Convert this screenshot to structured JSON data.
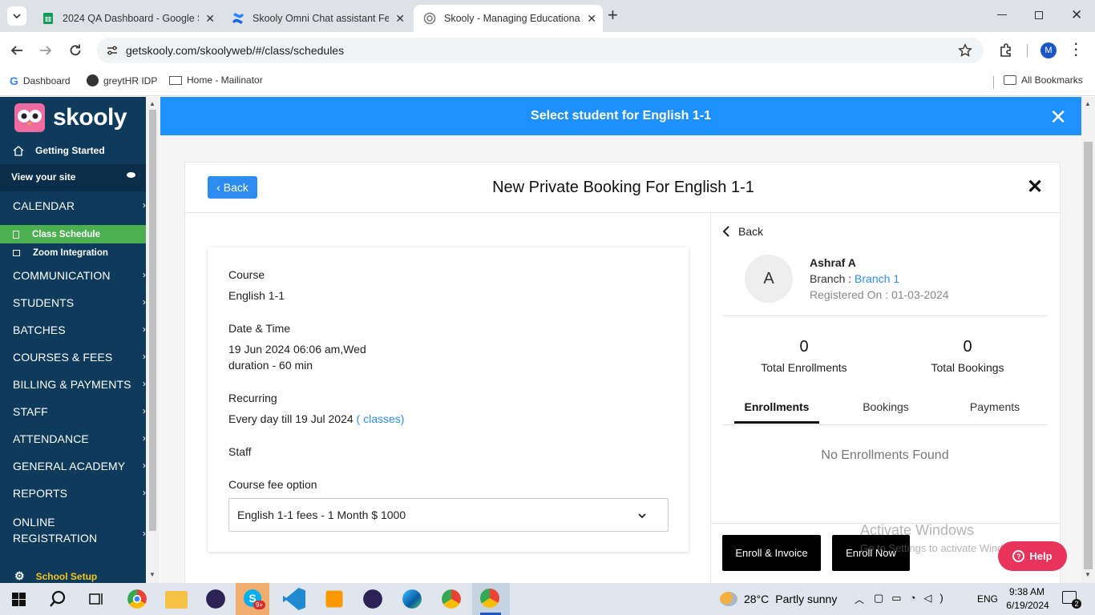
{
  "browser": {
    "tabs": [
      {
        "title": "2024 QA Dashboard - Google S",
        "icon": "sheets-icon"
      },
      {
        "title": "Skooly Omni Chat assistant Fea",
        "icon": "confluence-icon"
      },
      {
        "title": "Skooly - Managing Educational",
        "icon": "globe-icon"
      }
    ],
    "url": "getskooly.com/skoolyweb/#/class/schedules",
    "bookmarks": [
      "Dashboard",
      "greytHR IDP",
      "Home - Mailinator"
    ],
    "all_bookmarks": "All Bookmarks",
    "profile_initial": "M"
  },
  "sidebar": {
    "logo": "skooly",
    "getting_started": "Getting Started",
    "view_site": "View your site",
    "calendar": "CALENDAR",
    "class_schedule": "Class Schedule",
    "zoom": "Zoom Integration",
    "sections": [
      "COMMUNICATION",
      "STUDENTS",
      "BATCHES",
      "COURSES & FEES",
      "BILLING & PAYMENTS",
      "STAFF",
      "ATTENDANCE",
      "GENERAL ACADEMY",
      "REPORTS"
    ],
    "online_reg_1": "ONLINE",
    "online_reg_2": "REGISTRATION",
    "school_setup": "School Setup"
  },
  "banner": {
    "title": "Select student for English 1-1"
  },
  "modal": {
    "back": "Back",
    "title": "New Private Booking For English 1-1",
    "course_label": "Course",
    "course_value": "English 1-1",
    "datetime_label": "Date & Time",
    "datetime_value": "19 Jun 2024 06:06 am,Wed",
    "duration_value": "duration - 60 min",
    "recurring_label": "Recurring",
    "recurring_value": "Every day till 19 Jul 2024",
    "recurring_link": "( classes)",
    "staff_label": "Staff",
    "fee_label": "Course fee option",
    "fee_value": "English 1-1 fees - 1 Month $ 1000"
  },
  "student": {
    "back": "Back",
    "avatar_initial": "A",
    "name": "Ashraf A",
    "branch_label": "Branch :",
    "branch_value": "Branch 1",
    "registered": "Registered On : 01-03-2024",
    "total_enrollments_value": "0",
    "total_enrollments_label": "Total Enrollments",
    "total_bookings_value": "0",
    "total_bookings_label": "Total Bookings",
    "tabs": [
      "Enrollments",
      "Bookings",
      "Payments"
    ],
    "empty": "No Enrollments Found",
    "enroll_invoice": "Enroll & Invoice",
    "enroll_now": "Enroll Now",
    "help": "Help"
  },
  "watermark": {
    "line1": "Activate Windows",
    "line2": "Go to Settings to activate Windows."
  },
  "taskbar": {
    "weather_temp": "28°C",
    "weather_text": "Partly sunny",
    "lang": "ENG",
    "time": "9:38 AM",
    "date": "6/19/2024",
    "notif": "2",
    "skype_badge": "9+"
  },
  "colors": {
    "accent": "#1e90ff",
    "sidebar": "#0e3a5c",
    "active_item": "#4caf50",
    "help": "#e8345a"
  }
}
